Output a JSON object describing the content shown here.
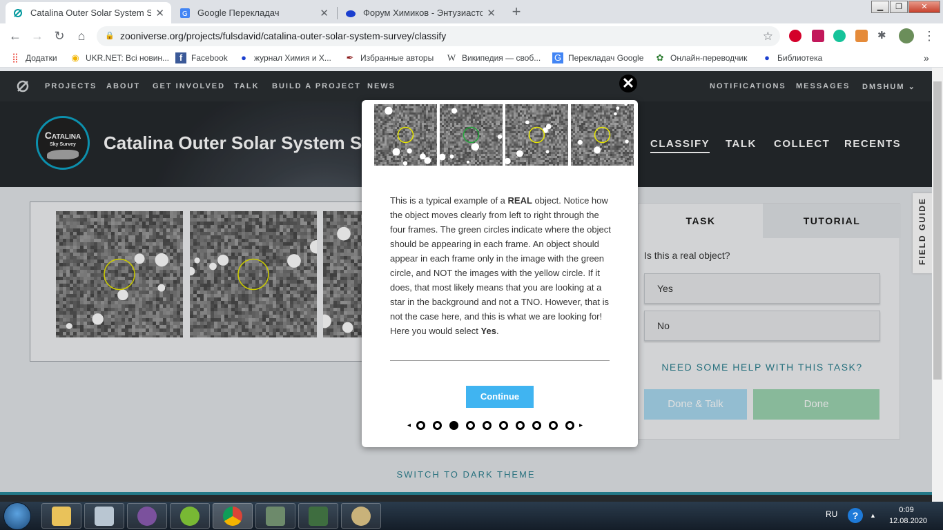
{
  "browser": {
    "tabs": [
      {
        "title": "Catalina Outer Solar System Surv",
        "active": true
      },
      {
        "title": "Google Перекладач",
        "active": false
      },
      {
        "title": "Форум Химиков - Энтузиастов.",
        "active": false
      }
    ],
    "close_symbol": "✕",
    "new_tab_symbol": "+",
    "url": "zooniverse.org/projects/fulsdavid/catalina-outer-solar-system-survey/classify",
    "bookmarks": [
      {
        "label": "Додатки",
        "icon": "apps-grid-icon"
      },
      {
        "label": "UKR.NET: Всі новин...",
        "icon": "ukrnet-icon"
      },
      {
        "label": "Facebook",
        "icon": "facebook-icon"
      },
      {
        "label": "журнал Химия и Х...",
        "icon": "chem-journal-icon"
      },
      {
        "label": "Избранные авторы",
        "icon": "feather-icon"
      },
      {
        "label": "Википедия — своб...",
        "icon": "wikipedia-icon"
      },
      {
        "label": "Перекладач Google",
        "icon": "google-translate-icon"
      },
      {
        "label": "Онлайн-переводчик",
        "icon": "translator-icon"
      },
      {
        "label": "Библиотека",
        "icon": "library-icon"
      }
    ],
    "bookmarks_more": "»"
  },
  "site": {
    "nav": [
      "PROJECTS",
      "ABOUT",
      "GET INVOLVED",
      "TALK",
      "BUILD A PROJECT",
      "NEWS"
    ],
    "nav_right": [
      "NOTIFICATIONS",
      "MESSAGES",
      "DMSHUM"
    ],
    "avatar_line1": "Catalina",
    "avatar_line2": "Sky Survey",
    "project_title": "Catalina Outer Solar System Survey",
    "project_nav": [
      "CLASSIFY",
      "TALK",
      "COLLECT",
      "RECENTS"
    ],
    "task_tabs": [
      "TASK",
      "TUTORIAL"
    ],
    "question": "Is this a real object?",
    "answers": [
      "Yes",
      "No"
    ],
    "help": "NEED SOME HELP WITH THIS TASK?",
    "done_talk": "Done & Talk",
    "done": "Done",
    "field_guide": "FIELD GUIDE",
    "dark_theme": "SWITCH TO DARK THEME",
    "accent": "#00979d"
  },
  "modal": {
    "close_symbol": "✕",
    "text_before_real": "This is a typical example of a ",
    "text_real": "REAL",
    "text_middle": " object. Notice how the object moves clearly from left to right through the four frames. The green circles indicate where the object should be appearing in each frame. An object should appear in each frame only in the image with the green circle, and NOT the images with the yellow circle. If it does, that most likely means that you are looking at a star in the background and not a TNO. However, that is not the case here, and this is what we are looking for! Here you would select ",
    "text_yes": "Yes",
    "text_end": ".",
    "continue": "Continue",
    "step_total": 10,
    "step_current": 3,
    "prev_symbol": "◂",
    "next_symbol": "▸"
  },
  "taskbar": {
    "lang": "RU",
    "time": "0:09",
    "date": "12.08.2020"
  }
}
